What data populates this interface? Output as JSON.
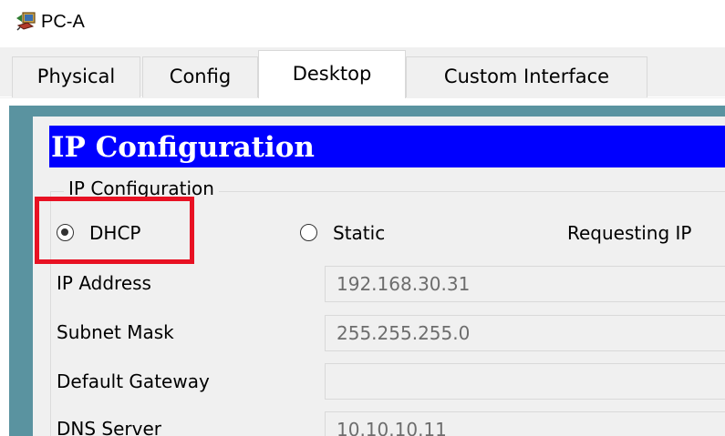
{
  "window": {
    "title": "PC-A",
    "icon": "pc-router-icon"
  },
  "tabs": [
    {
      "label": "Physical"
    },
    {
      "label": "Config"
    },
    {
      "label": "Desktop"
    },
    {
      "label": "Custom Interface"
    }
  ],
  "active_tab": "Desktop",
  "app": {
    "header": "IP Configuration"
  },
  "group": {
    "legend": "IP Configuration",
    "dhcp_label": "DHCP",
    "static_label": "Static",
    "selected_mode": "DHCP",
    "status": "Requesting IP"
  },
  "fields": {
    "ip_address": {
      "label": "IP Address",
      "value": "192.168.30.31"
    },
    "subnet_mask": {
      "label": "Subnet Mask",
      "value": "255.255.255.0"
    },
    "default_gateway": {
      "label": "Default Gateway",
      "value": ""
    },
    "dns_server": {
      "label": "DNS Server",
      "value": "10.10.10.11"
    }
  },
  "colors": {
    "header_bg": "#0000ff",
    "frame_teal": "#5a93a0",
    "annotation_red": "#e81123"
  }
}
